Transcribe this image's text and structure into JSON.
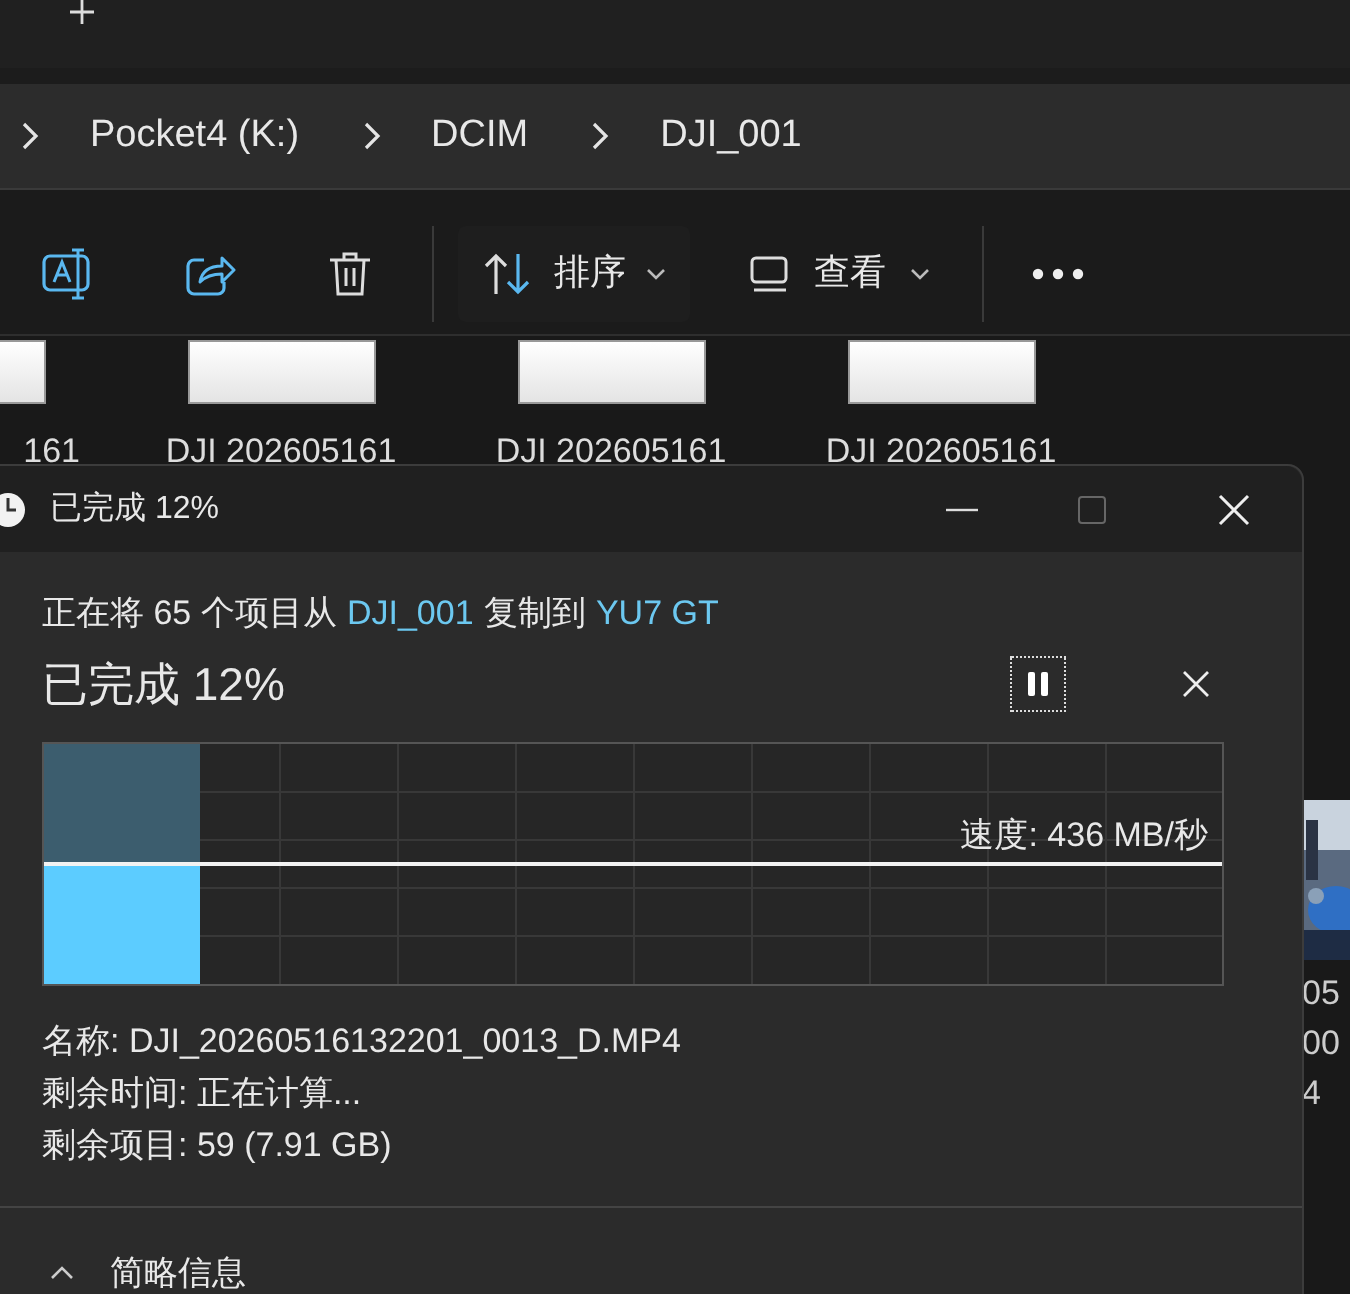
{
  "explorer": {
    "breadcrumbs": [
      "Pocket4 (K:)",
      "DCIM",
      "DJI_001"
    ],
    "toolbar": {
      "sort_label": "排序",
      "view_label": "查看"
    },
    "files": [
      {
        "label": "161"
      },
      {
        "label": "DJI 202605161"
      },
      {
        "label": "DJI 202605161"
      },
      {
        "label": "DJI 202605161"
      }
    ],
    "peek_labels": [
      "05",
      "00",
      "4"
    ]
  },
  "dialog": {
    "title": "已完成 12%",
    "message": [
      {
        "kind": "plain",
        "text": "正在将 65 个项目从"
      },
      {
        "kind": "link",
        "text": "DJI_001"
      },
      {
        "kind": "plain",
        "text": "复制到"
      },
      {
        "kind": "link",
        "text": "YU7 GT"
      }
    ],
    "heading": "已完成 12%",
    "progress": {
      "level": 0.132
    },
    "speed": "速度: 436 MB/秒",
    "details": [
      "名称: DJI_20260516132201_0013_D.MP4",
      "剩余时间: 正在计算...",
      "剩余项目: 59 (7.91 GB)"
    ],
    "footer": "简略信息"
  }
}
